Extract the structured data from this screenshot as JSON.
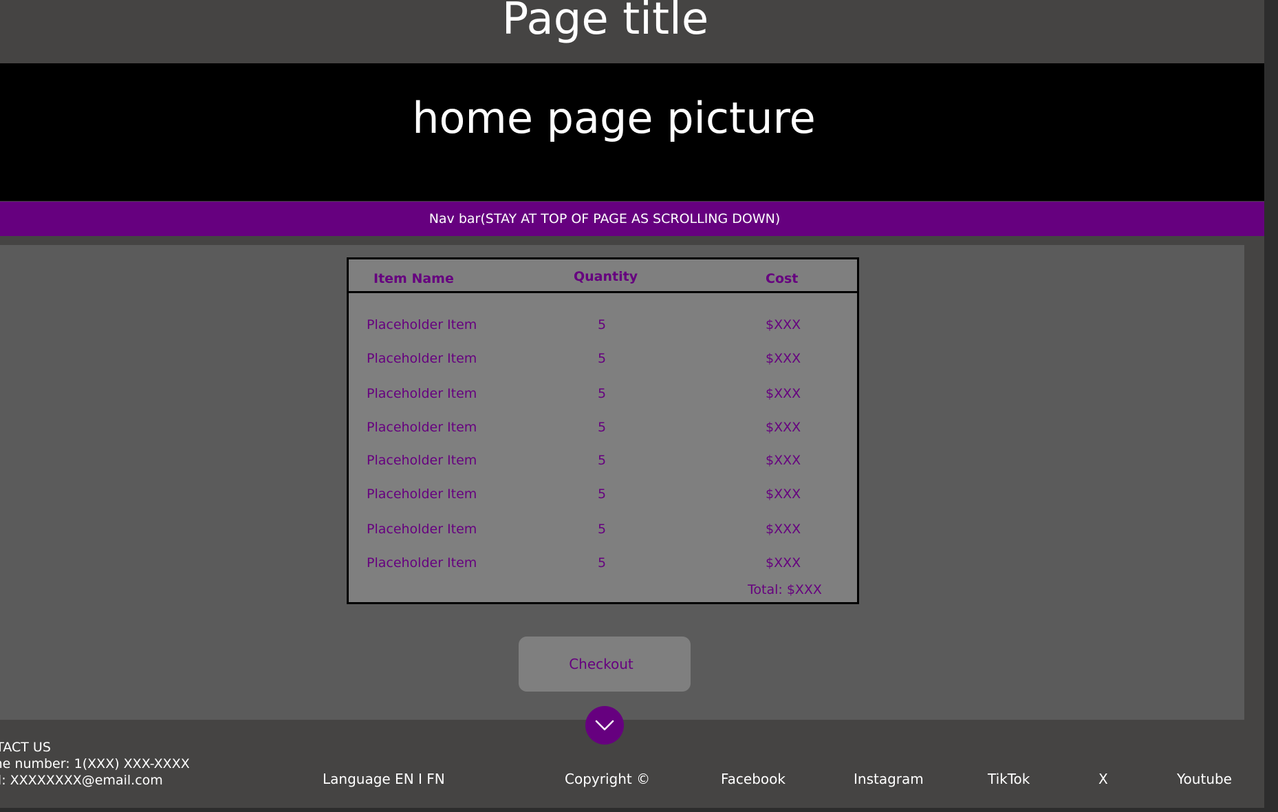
{
  "header": {
    "page_title": "Page title"
  },
  "hero": {
    "text": "home page picture"
  },
  "navbar": {
    "text": "Nav bar(STAY AT TOP OF PAGE AS SCROLLING DOWN)"
  },
  "cart": {
    "columns": {
      "name": "Item Name",
      "quantity": "Quantity",
      "cost": "Cost"
    },
    "rows": [
      {
        "name": "Placeholder Item",
        "quantity": "5",
        "cost": "$XXX"
      },
      {
        "name": "Placeholder Item",
        "quantity": "5",
        "cost": "$XXX"
      },
      {
        "name": "Placeholder Item",
        "quantity": "5",
        "cost": "$XXX"
      },
      {
        "name": "Placeholder Item",
        "quantity": "5",
        "cost": "$XXX"
      },
      {
        "name": "Placeholder Item",
        "quantity": "5",
        "cost": "$XXX"
      },
      {
        "name": "Placeholder Item",
        "quantity": "5",
        "cost": "$XXX"
      },
      {
        "name": "Placeholder Item",
        "quantity": "5",
        "cost": "$XXX"
      },
      {
        "name": "Placeholder Item",
        "quantity": "5",
        "cost": "$XXX"
      }
    ],
    "total": "Total: $XXX"
  },
  "checkout": {
    "label": "Checkout"
  },
  "scroll_button": {
    "icon": "chevron-down-icon"
  },
  "footer": {
    "contact": {
      "heading": "NTACT US",
      "phone": "one number: 1(XXX) XXX-XXXX",
      "email": "ail: XXXXXXXX@email.com"
    },
    "language": "Language EN I FN",
    "copyright": "Copyright ©",
    "social": {
      "facebook": "Facebook",
      "instagram": "Instagram",
      "tiktok": "TikTok",
      "x": "X",
      "youtube": "Youtube"
    }
  },
  "colors": {
    "accent": "#66007f",
    "hero_bg": "#000000",
    "page_bg": "#454443",
    "content_bg": "#5b5b5b",
    "table_bg": "#7f7f7f"
  }
}
